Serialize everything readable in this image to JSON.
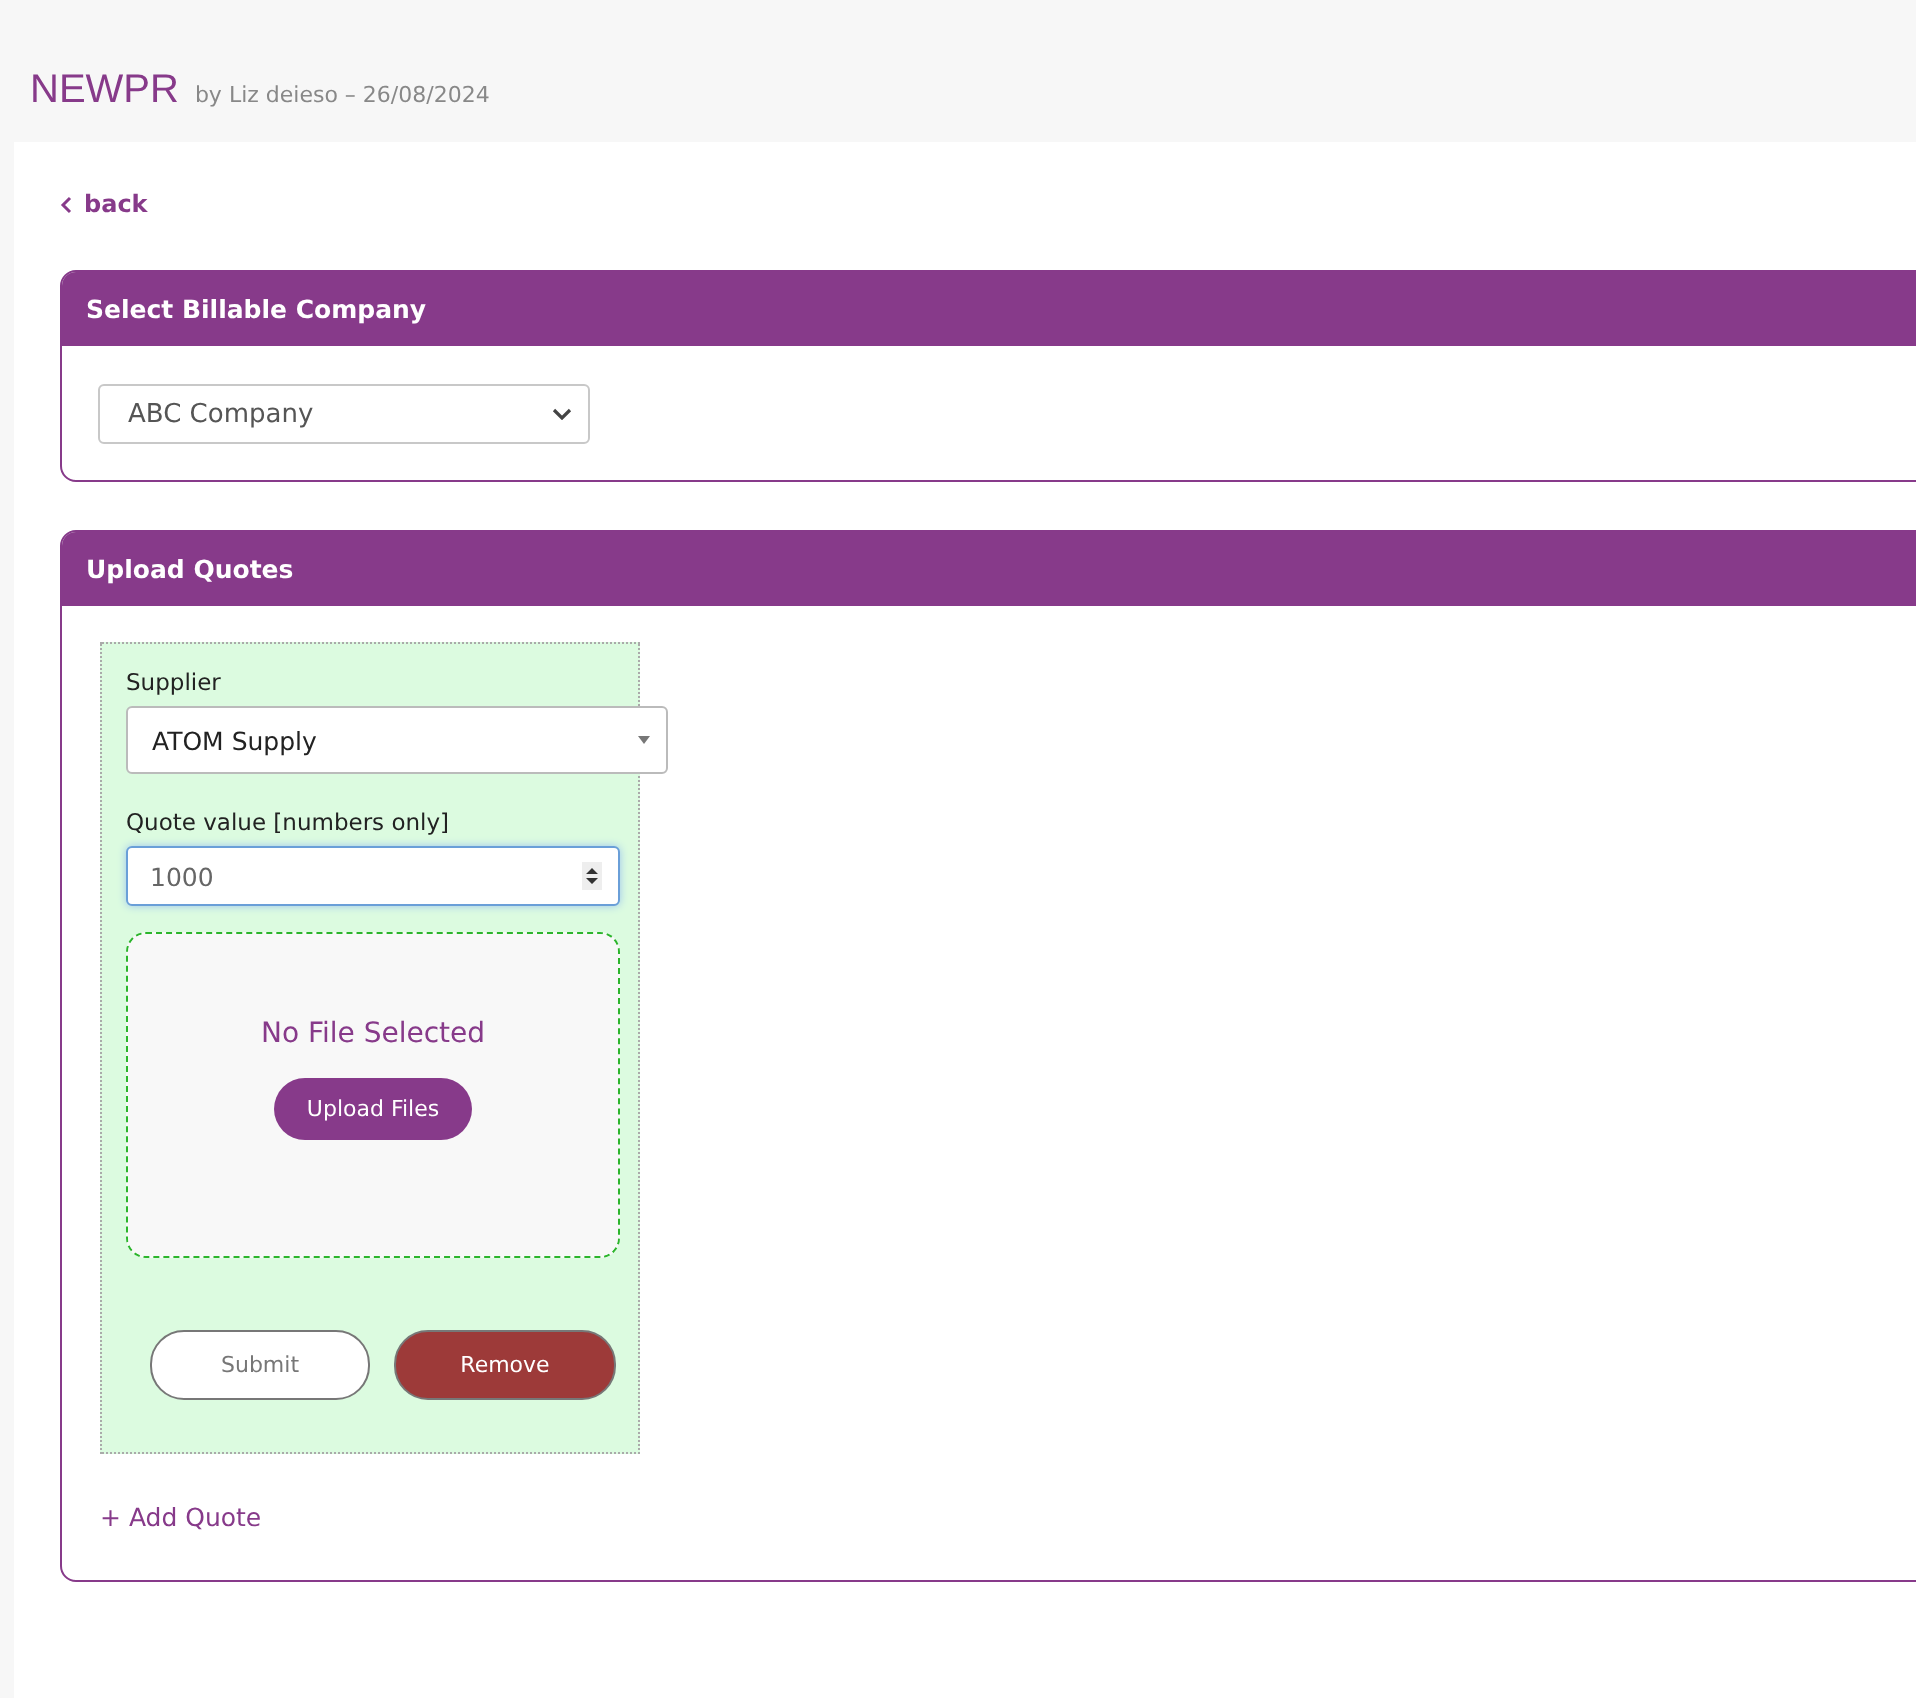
{
  "header": {
    "title": "NEWPR",
    "byline": "by Liz deieso – 26/08/2024"
  },
  "back_link": {
    "label": "back"
  },
  "billable_company": {
    "title": "Select Billable Company",
    "select": {
      "value": "ABC Company"
    }
  },
  "upload_quotes": {
    "title": "Upload Quotes",
    "quotes": [
      {
        "supplier_label": "Supplier",
        "supplier": "ATOM Supply",
        "value_label": "Quote value [numbers only]",
        "value": "1000",
        "focused": true,
        "file_status": "No File Selected",
        "upload_button": "Upload Files",
        "submit_button": "Submit",
        "remove_button": "Remove"
      }
    ],
    "add_quote": "+ Add Quote"
  }
}
